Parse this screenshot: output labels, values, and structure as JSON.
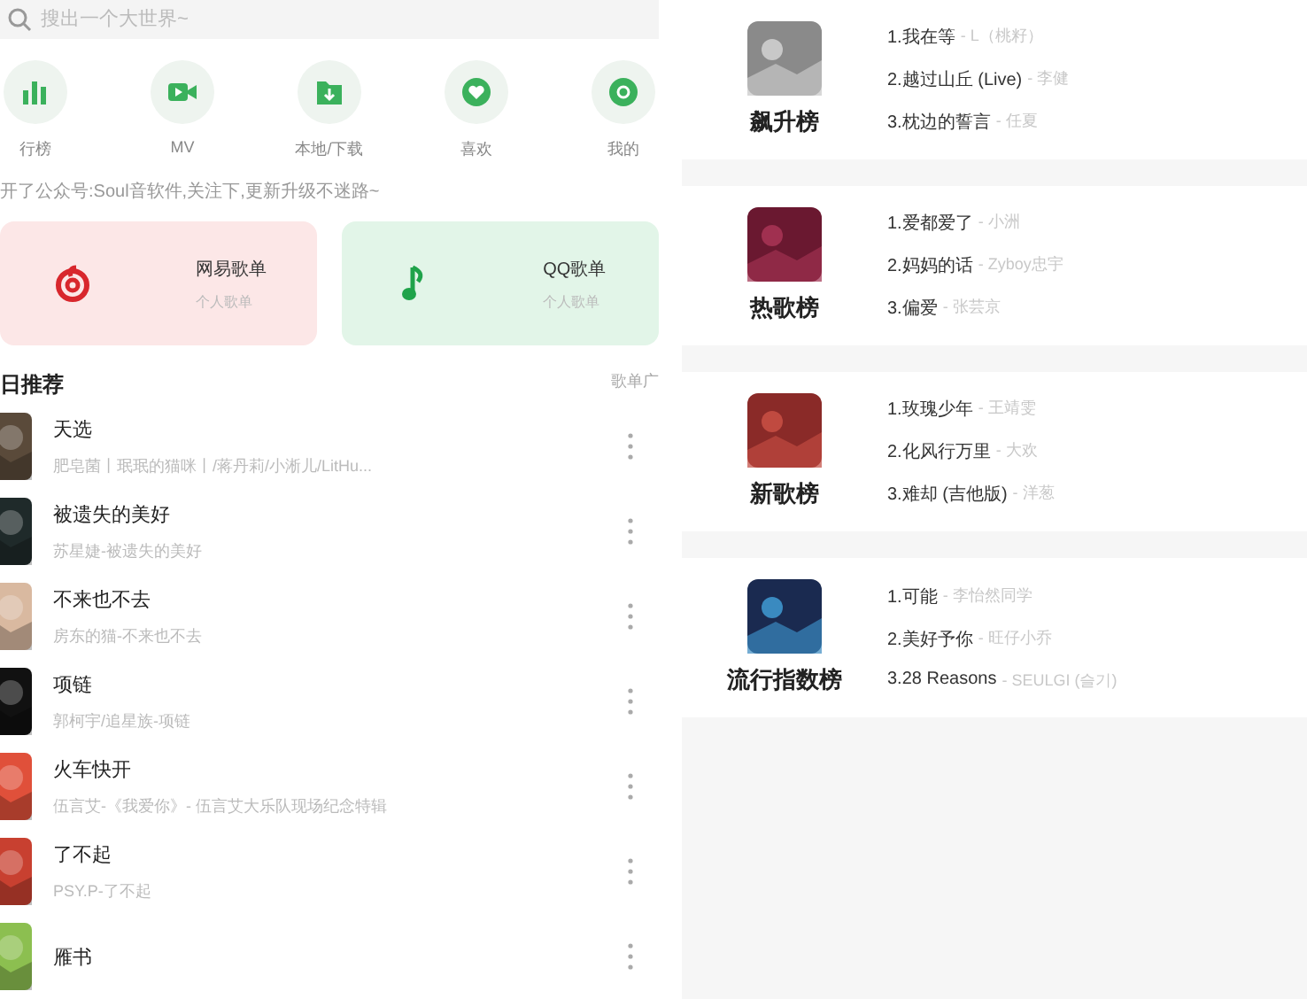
{
  "search": {
    "placeholder": "搜出一个大世界~"
  },
  "shortcuts": [
    {
      "label": "行榜",
      "kind": "chart"
    },
    {
      "label": "MV",
      "kind": "video"
    },
    {
      "label": "本地/下载",
      "kind": "download"
    },
    {
      "label": "喜欢",
      "kind": "heart"
    },
    {
      "label": "我的",
      "kind": "disc"
    }
  ],
  "notice": "开了公众号:Soul音软件,关注下,更新升级不迷路~",
  "playlist_cards": [
    {
      "title": "网易歌单",
      "subtitle": "个人歌单",
      "kind": "netease"
    },
    {
      "title": "QQ歌单",
      "subtitle": "个人歌单",
      "kind": "qq"
    }
  ],
  "daily": {
    "title": "日推荐",
    "link": "歌单广",
    "songs": [
      {
        "title": "天选",
        "subtitle": "肥皂菌丨珉珉的猫咪丨/蒋丹莉/小淅儿/LitHu..."
      },
      {
        "title": "被遗失的美好",
        "subtitle": "苏星婕-被遗失的美好"
      },
      {
        "title": "不来也不去",
        "subtitle": "房东的猫-不来也不去"
      },
      {
        "title": "项链",
        "subtitle": "郭柯宇/追星族-项链"
      },
      {
        "title": "火车快开",
        "subtitle": "伍言艾-《我爱你》- 伍言艾大乐队现场纪念特辑"
      },
      {
        "title": "了不起",
        "subtitle": "PSY.P-了不起"
      },
      {
        "title": "雁书"
      }
    ]
  },
  "charts": [
    {
      "name": "飙升榜",
      "tracks": [
        {
          "song": "1.我在等",
          "artist": "- L（桃籽）"
        },
        {
          "song": "2.越过山丘 (Live)",
          "artist": "- 李健"
        },
        {
          "song": "3.枕边的誓言",
          "artist": "- 任夏"
        }
      ]
    },
    {
      "name": "热歌榜",
      "tracks": [
        {
          "song": "1.爱都爱了",
          "artist": "- 小洲"
        },
        {
          "song": "2.妈妈的话",
          "artist": "- Zyboy忠宇"
        },
        {
          "song": "3.偏爱",
          "artist": "- 张芸京"
        }
      ]
    },
    {
      "name": "新歌榜",
      "tracks": [
        {
          "song": "1.玫瑰少年",
          "artist": "- 王靖雯"
        },
        {
          "song": "2.化风行万里",
          "artist": "- 大欢"
        },
        {
          "song": "3.难却 (吉他版)",
          "artist": "- 洋葱"
        }
      ]
    },
    {
      "name": "流行指数榜",
      "tracks": [
        {
          "song": "1.可能",
          "artist": "- 李怡然同学"
        },
        {
          "song": "2.美好予你",
          "artist": "- 旺仔小乔"
        },
        {
          "song": "3.28 Reasons",
          "artist": "- SEULGI (슬기)"
        }
      ]
    }
  ]
}
